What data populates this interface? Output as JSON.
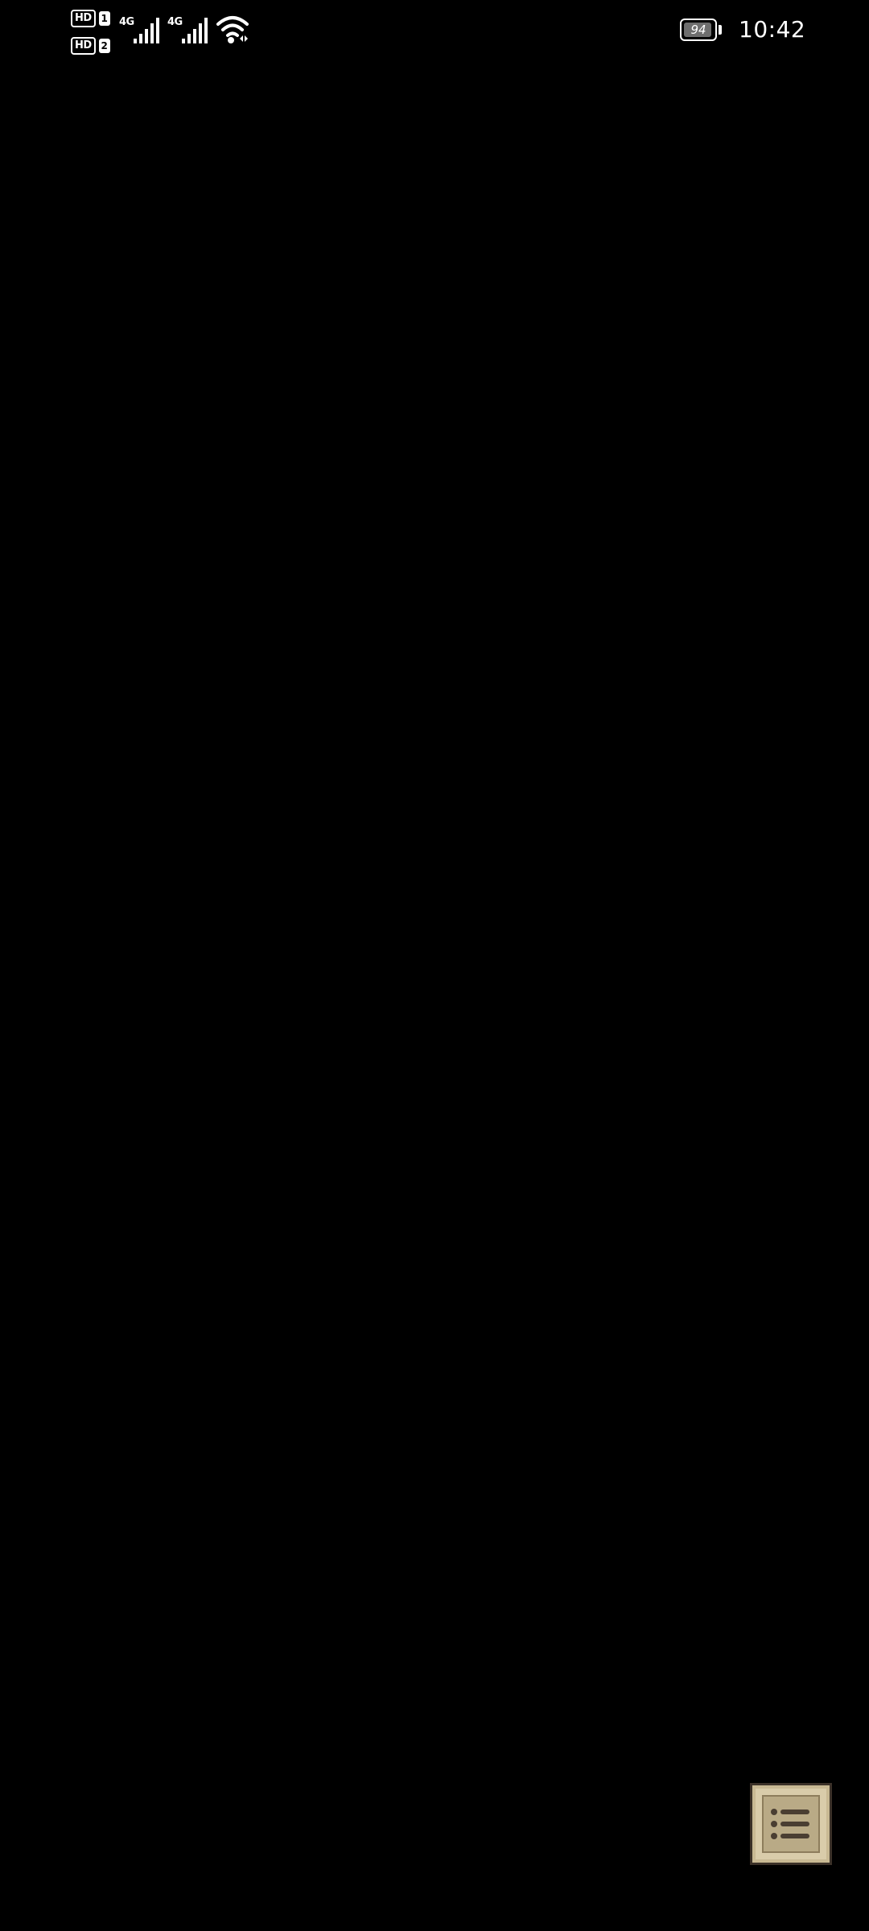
{
  "status_bar": {
    "sim1": {
      "badge": "HD",
      "slot": "1",
      "network": "4G",
      "signal_bars": 5,
      "signal_icon": "cellular-signal-icon"
    },
    "sim2": {
      "badge": "HD",
      "slot": "2",
      "network": "4G",
      "signal_bars": 5,
      "signal_icon": "cellular-signal-icon"
    },
    "wifi_icon": "wifi-icon",
    "battery": {
      "level": "94",
      "level_fraction": 0.94,
      "icon": "battery-icon"
    },
    "time": "10:42"
  },
  "main": {
    "background_color": "#000000"
  },
  "menu_button": {
    "icon": "list-menu-icon",
    "colors": {
      "face": "#d9ccaa",
      "border": "#3b3128",
      "lines": "#4a3e32"
    }
  }
}
